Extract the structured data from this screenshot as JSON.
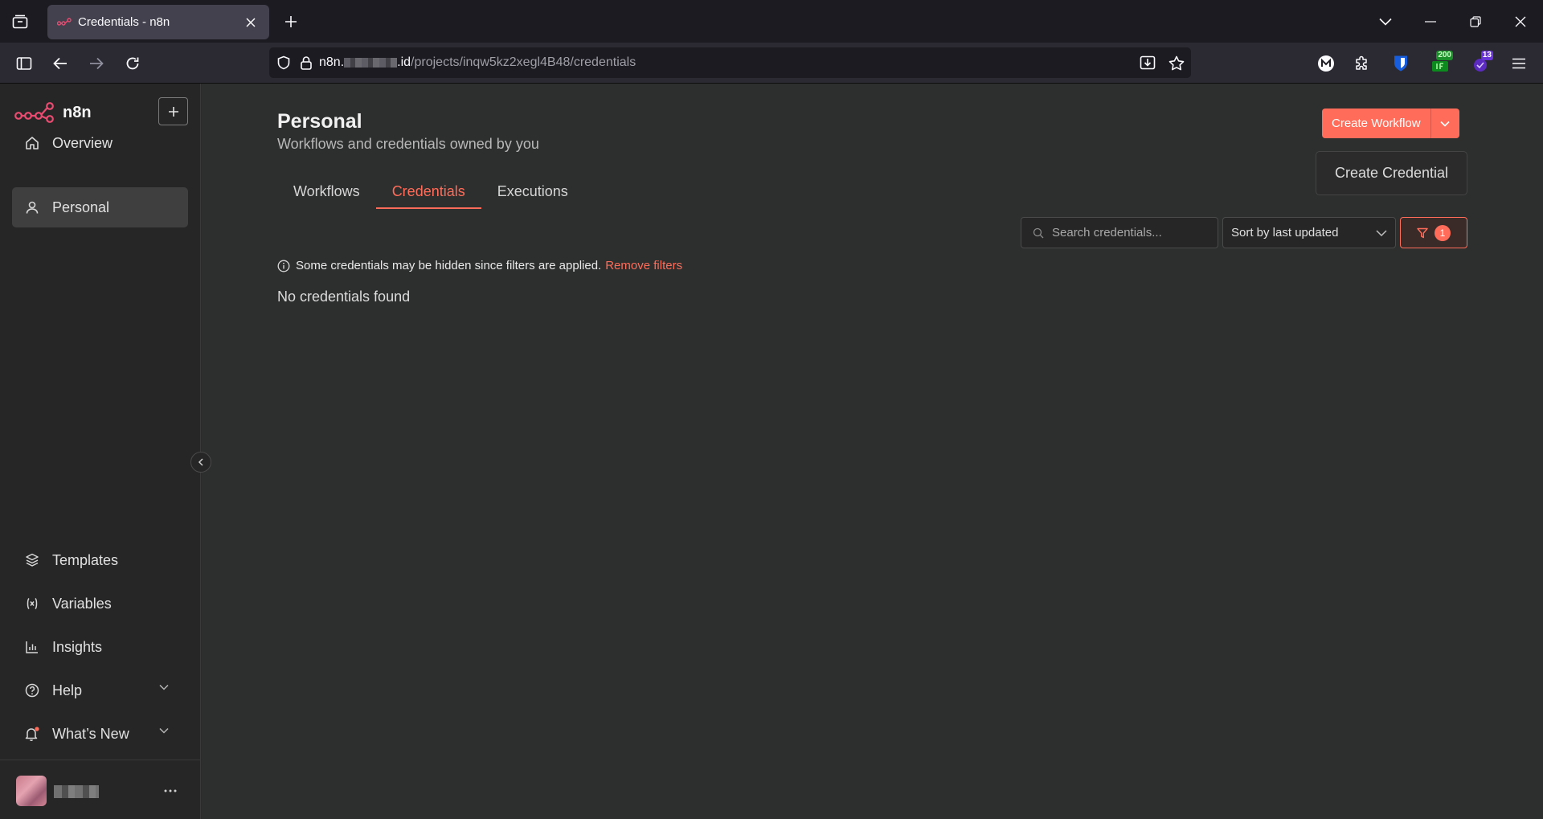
{
  "browser": {
    "tab_title": "Credentials - n8n",
    "url_host": "n8n.",
    "url_host_tld": ".id",
    "url_path": "/projects/inqw5kz2xegl4B48/credentials",
    "ext_badge_1": "200",
    "ext_badge_2": "13"
  },
  "sidebar": {
    "logo_text": "n8n",
    "items_top": [
      {
        "label": "Overview",
        "icon": "home-icon"
      },
      {
        "label": "Personal",
        "icon": "user-icon"
      }
    ],
    "items_bottom": [
      {
        "label": "Templates",
        "icon": "templates-icon"
      },
      {
        "label": "Variables",
        "icon": "variables-icon"
      },
      {
        "label": "Insights",
        "icon": "insights-icon"
      },
      {
        "label": "Help",
        "icon": "help-icon"
      },
      {
        "label": "What’s New",
        "icon": "bell-icon"
      }
    ]
  },
  "page": {
    "title": "Personal",
    "subtitle": "Workflows and credentials owned by you",
    "tabs": [
      "Workflows",
      "Credentials",
      "Executions"
    ],
    "active_tab": "Credentials",
    "create_workflow_label": "Create Workflow",
    "create_credential_label": "Create Credential",
    "search_placeholder": "Search credentials...",
    "sort_value": "Sort by last updated",
    "filter_count": "1",
    "notice_text": "Some credentials may be hidden since filters are applied.",
    "notice_link": "Remove filters",
    "empty_text": "No credentials found"
  },
  "colors": {
    "accent": "#ff6d5a",
    "sidebar_bg": "#262626",
    "main_bg": "#2d2e2e"
  }
}
